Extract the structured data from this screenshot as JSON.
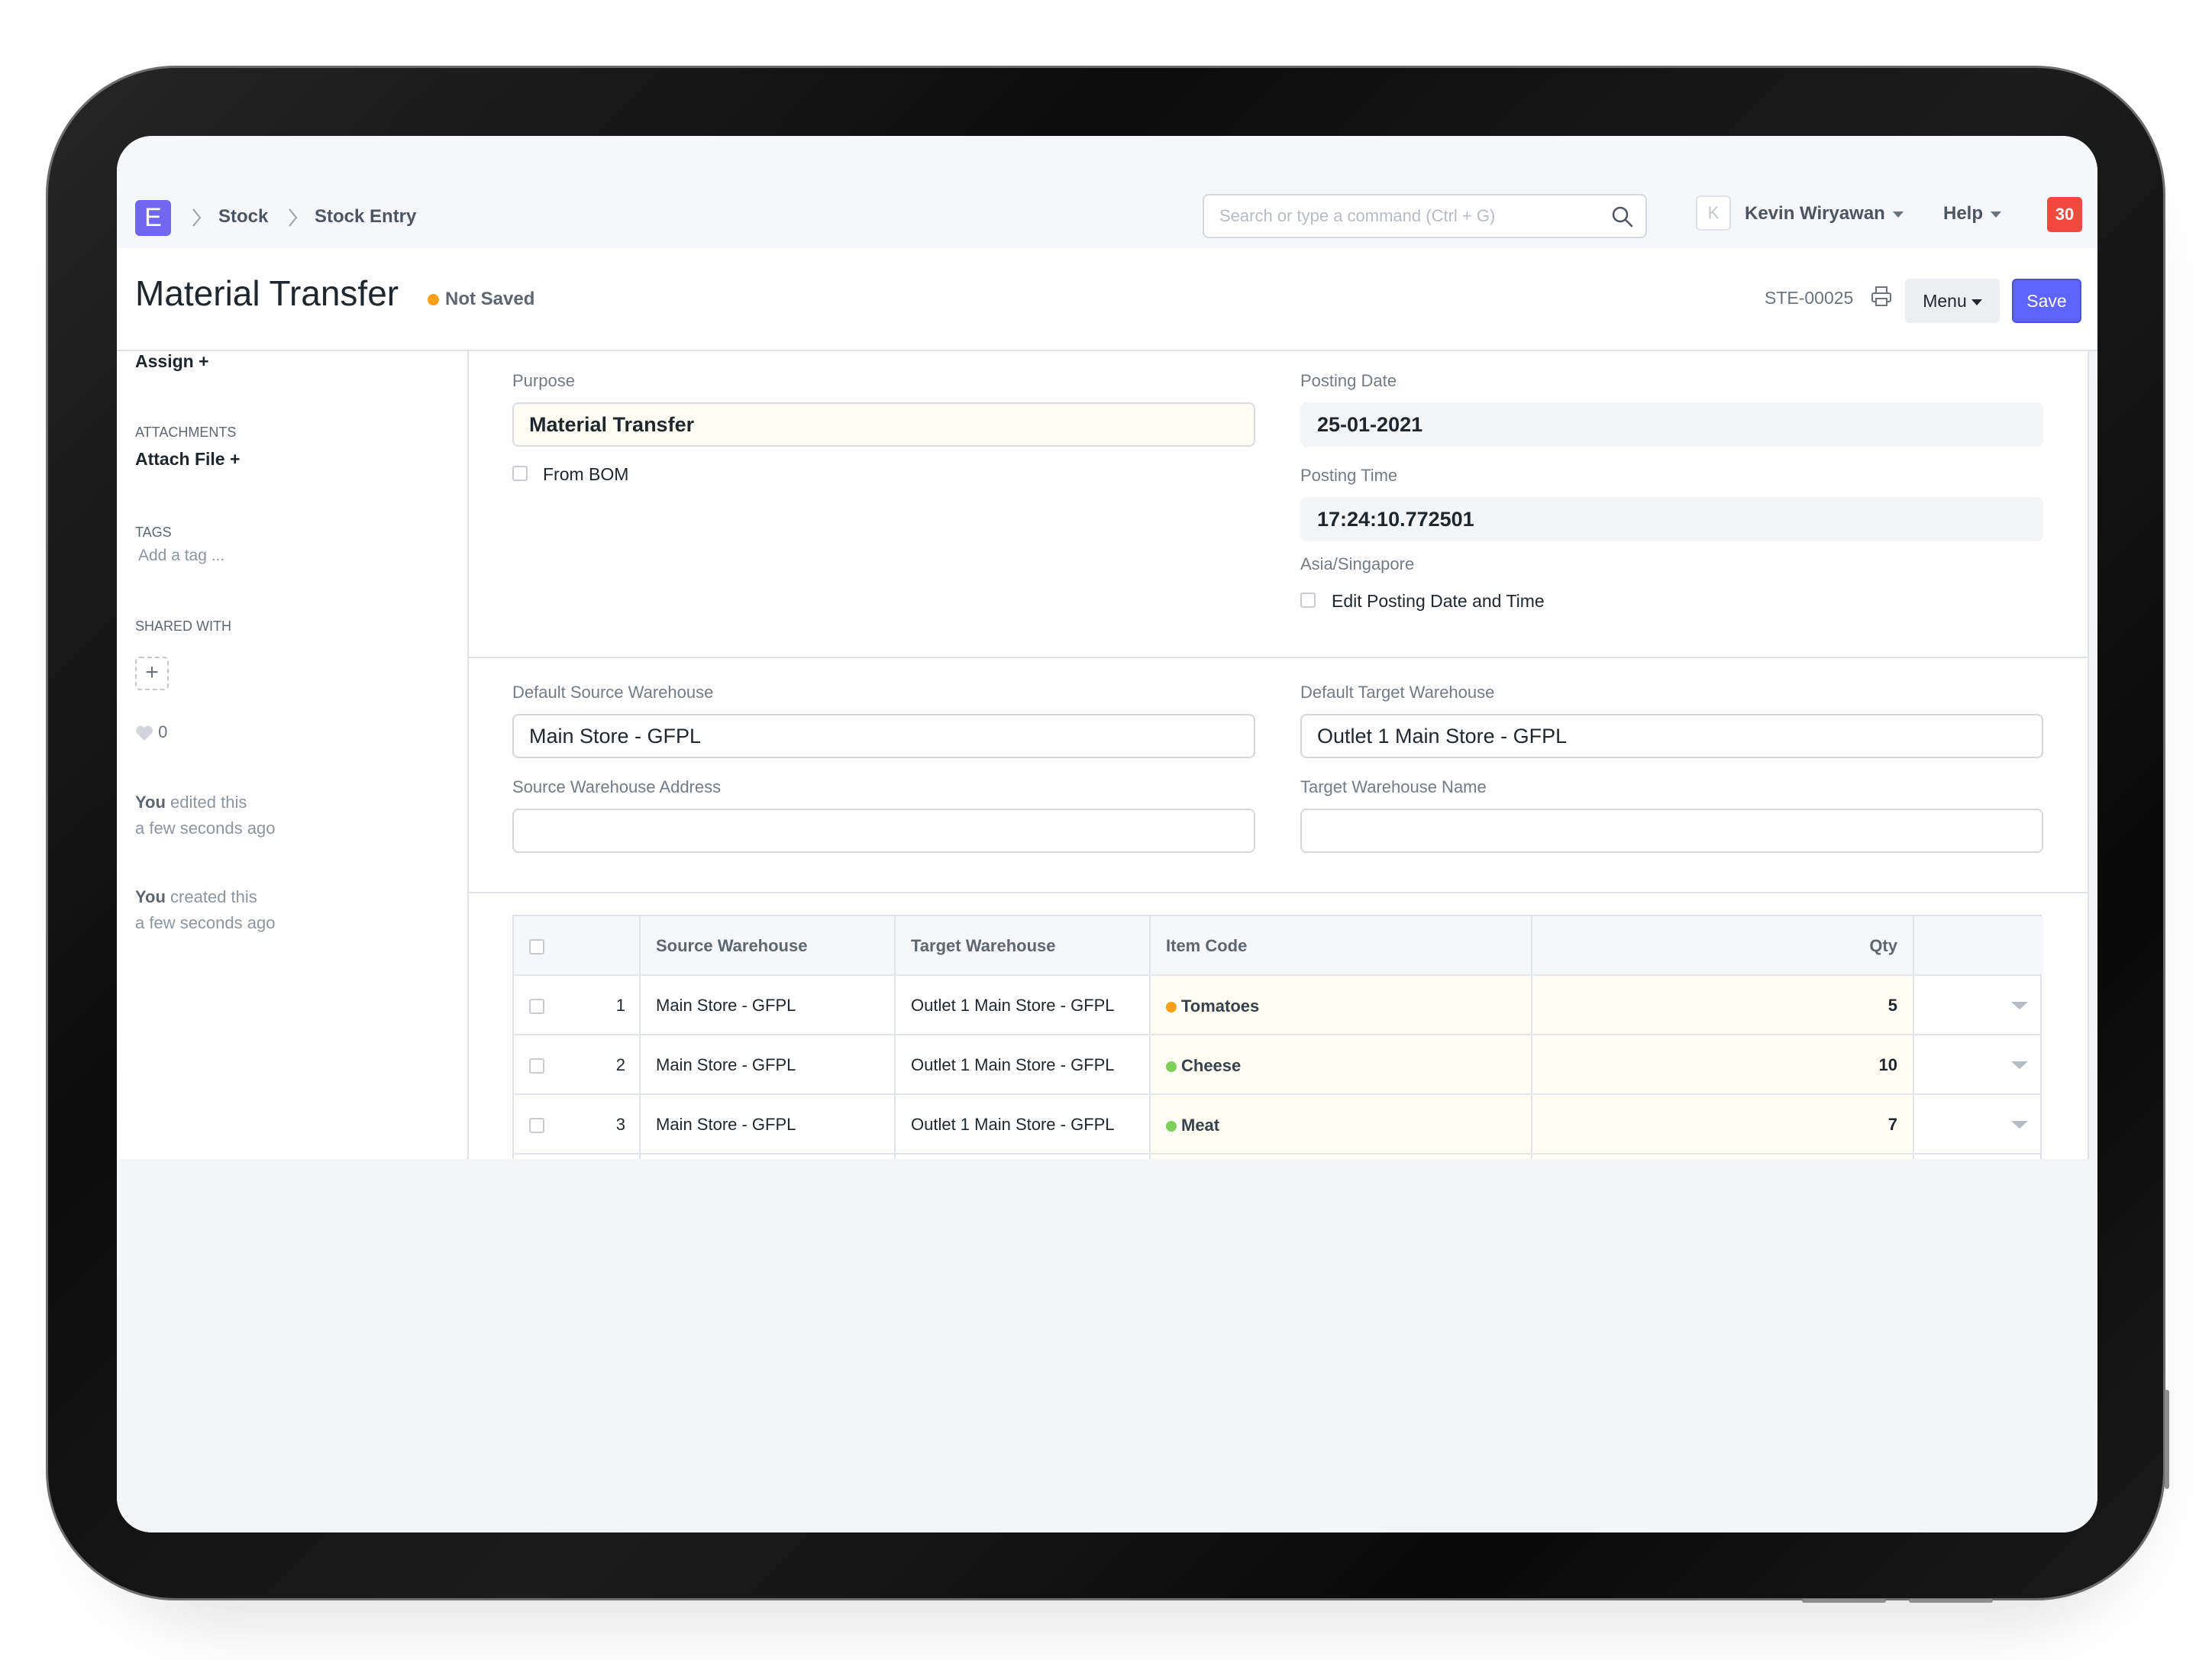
{
  "navbar": {
    "logo_letter": "E",
    "breadcrumbs": [
      "Stock",
      "Stock Entry"
    ],
    "search_placeholder": "Search or type a command (Ctrl + G)",
    "avatar_letter": "K",
    "user_name": "Kevin Wiryawan",
    "help_label": "Help",
    "notification_count": "30"
  },
  "page": {
    "title": "Material Transfer",
    "status": "Not Saved",
    "status_color": "#f8a11b",
    "doc_name": "STE-00025",
    "menu_label": "Menu",
    "save_label": "Save"
  },
  "sidebar": {
    "assign_label": "Assign",
    "attachments_heading": "ATTACHMENTS",
    "attach_file_label": "Attach File",
    "tags_heading": "TAGS",
    "add_tag_placeholder": "Add a tag ...",
    "shared_with_heading": "SHARED WITH",
    "likes_count": "0",
    "activity": [
      {
        "actor": "You",
        "action": "edited this",
        "time": "a few seconds ago"
      },
      {
        "actor": "You",
        "action": "created this",
        "time": "a few seconds ago"
      }
    ]
  },
  "form": {
    "purpose_label": "Purpose",
    "purpose_value": "Material Transfer",
    "from_bom_label": "From BOM",
    "posting_date_label": "Posting Date",
    "posting_date_value": "25-01-2021",
    "posting_time_label": "Posting Time",
    "posting_time_value": "17:24:10.772501",
    "timezone": "Asia/Singapore",
    "edit_posting_label": "Edit Posting Date and Time",
    "default_source_label": "Default Source Warehouse",
    "default_source_value": "Main Store - GFPL",
    "default_target_label": "Default Target Warehouse",
    "default_target_value": "Outlet 1 Main Store - GFPL",
    "source_address_label": "Source Warehouse Address",
    "source_address_value": "",
    "target_name_label": "Target Warehouse Name",
    "target_name_value": ""
  },
  "items_table": {
    "columns": [
      "Source Warehouse",
      "Target Warehouse",
      "Item Code",
      "Qty"
    ],
    "rows": [
      {
        "idx": "1",
        "source": "Main Store - GFPL",
        "target": "Outlet 1 Main Store - GFPL",
        "item": "Tomatoes",
        "item_color": "#f8a11b",
        "qty": "5"
      },
      {
        "idx": "2",
        "source": "Main Store - GFPL",
        "target": "Outlet 1 Main Store - GFPL",
        "item": "Cheese",
        "item_color": "#7cd05a",
        "qty": "10"
      },
      {
        "idx": "3",
        "source": "Main Store - GFPL",
        "target": "Outlet 1 Main Store - GFPL",
        "item": "Meat",
        "item_color": "#7cd05a",
        "qty": "7"
      }
    ]
  },
  "colors": {
    "primary": "#5e64ff",
    "notification": "#f04a3f",
    "logo": "#6f67f0"
  }
}
